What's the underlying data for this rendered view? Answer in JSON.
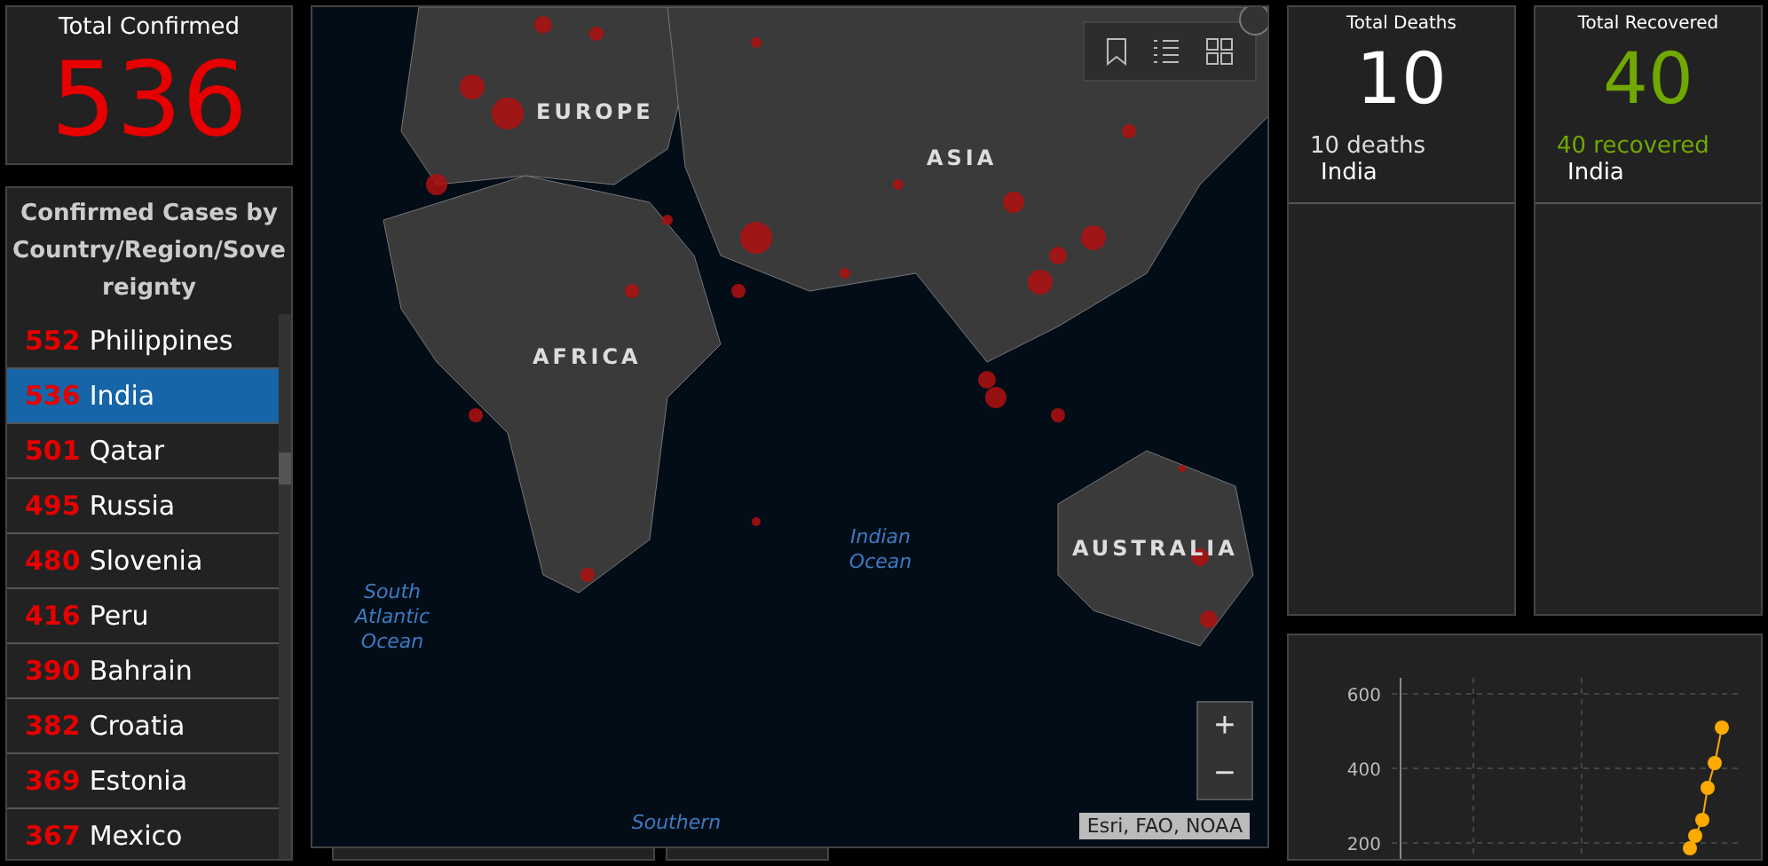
{
  "total_confirmed": {
    "label": "Total Confirmed",
    "value": "536"
  },
  "country_list": {
    "title": "Confirmed Cases by Country/Region/Sovereignty",
    "items": [
      {
        "count": "552",
        "name": "Philippines",
        "selected": false
      },
      {
        "count": "536",
        "name": "India",
        "selected": true
      },
      {
        "count": "501",
        "name": "Qatar",
        "selected": false
      },
      {
        "count": "495",
        "name": "Russia",
        "selected": false
      },
      {
        "count": "480",
        "name": "Slovenia",
        "selected": false
      },
      {
        "count": "416",
        "name": "Peru",
        "selected": false
      },
      {
        "count": "390",
        "name": "Bahrain",
        "selected": false
      },
      {
        "count": "382",
        "name": "Croatia",
        "selected": false
      },
      {
        "count": "369",
        "name": "Estonia",
        "selected": false
      },
      {
        "count": "367",
        "name": "Mexico",
        "selected": false
      }
    ]
  },
  "map": {
    "labels": [
      {
        "text": "EUROPE",
        "kind": "region"
      },
      {
        "text": "ASIA",
        "kind": "region"
      },
      {
        "text": "AFRICA",
        "kind": "region"
      },
      {
        "text": "Indian Ocean",
        "kind": "ocean"
      },
      {
        "text": "AUSTRALIA",
        "kind": "region"
      },
      {
        "text": "South Atlantic Ocean",
        "kind": "ocean"
      },
      {
        "text": "Southern",
        "kind": "ocean"
      }
    ],
    "zoom_in": "+",
    "zoom_out": "−",
    "attribution": "Esri, FAO, NOAA"
  },
  "deaths": {
    "label": "Total Deaths",
    "value": "10",
    "detail_count": "10",
    "detail_text": "deaths",
    "place": "India"
  },
  "recovered": {
    "label": "Total Recovered",
    "value": "40",
    "detail_count": "40",
    "detail_text": "recovered",
    "place": "India"
  },
  "chart": {
    "y_axis_labels": [
      "600",
      "400",
      "200"
    ]
  }
}
